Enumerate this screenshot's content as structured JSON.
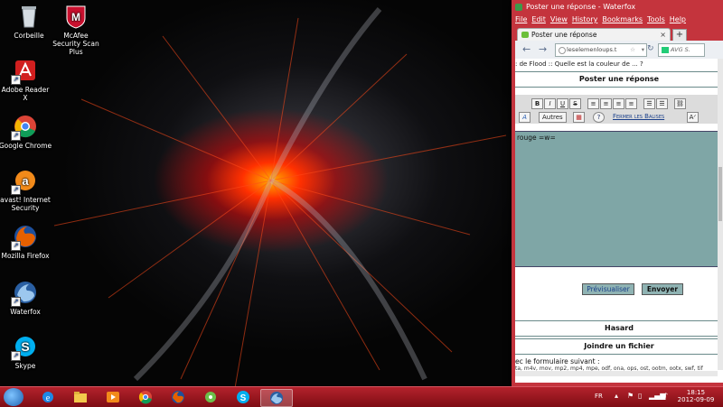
{
  "desktop": {
    "icons": [
      {
        "name": "recycle-bin-icon",
        "label": "Corbeille",
        "color": "#cfd6dc"
      },
      {
        "name": "mcafee-icon",
        "label": "McAfee Security Scan Plus",
        "color": "#c8102e"
      },
      {
        "name": "adobe-reader-icon",
        "label": "Adobe Reader X",
        "color": "#d11f1f"
      },
      {
        "name": "google-chrome-icon",
        "label": "Google Chrome",
        "color": "#2f9a46"
      },
      {
        "name": "avast-icon",
        "label": "avast! Internet Security",
        "color": "#f28a1a"
      },
      {
        "name": "firefox-icon",
        "label": "Mozilla Firefox",
        "color": "#e66000"
      },
      {
        "name": "waterfox-icon",
        "label": "Waterfox",
        "color": "#3a73b8"
      },
      {
        "name": "skype-icon",
        "label": "Skype",
        "color": "#00aff0"
      }
    ]
  },
  "browser": {
    "window_title": "Poster une réponse - Waterfox",
    "menu": [
      "File",
      "Edit",
      "View",
      "History",
      "Bookmarks",
      "Tools",
      "Help"
    ],
    "tab_label": "Poster une réponse",
    "tab_close": "×",
    "new_tab": "+",
    "url": "leselemenloups.t",
    "search_placeholder": "AVG S.",
    "page": {
      "breadcrumb": ": de Flood :: Quelle est la couleur de ... ?",
      "section_title": "Poster une réponse",
      "toolbar": {
        "buttons": [
          "B",
          "I",
          "U",
          "S"
        ],
        "autres": "Autres",
        "fermer": "Fermer les Balises"
      },
      "editor_text": "rouge =w=",
      "preview_button": "Prévisualiser",
      "submit_button": "Envoyer",
      "hasard_label": "Hasard",
      "attach_label": "Joindre un fichier",
      "form_text": "ec le formulaire suivant :",
      "extensions": "ta, m4v, mov, mp2, mp4, mpe, odf, ona, ops, ost, ootm, ootx, swf, tif"
    }
  },
  "taskbar": {
    "lang": "FR",
    "time": "18:15",
    "date": "2012-09-09",
    "colors": {
      "accent": "#b4222c"
    }
  }
}
